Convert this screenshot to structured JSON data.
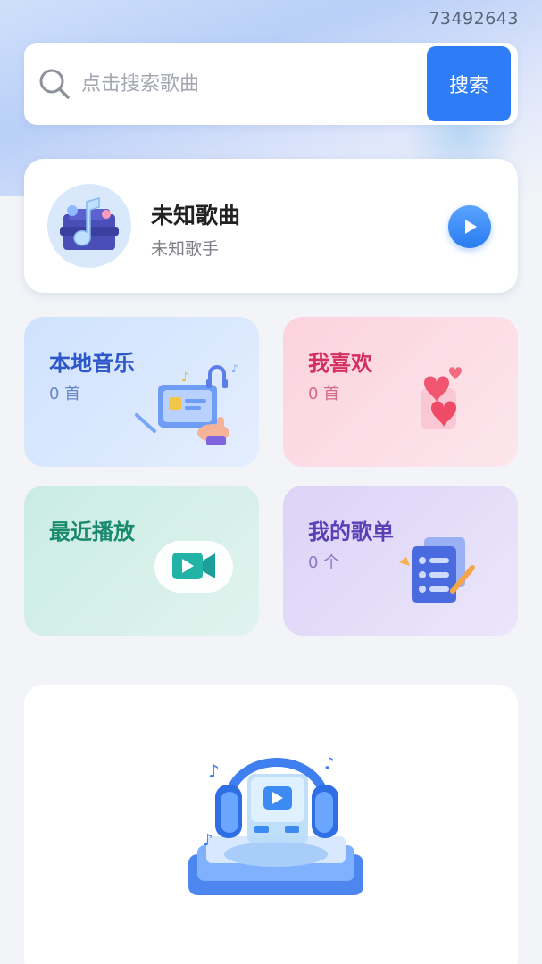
{
  "status": {
    "user_id": "73492643"
  },
  "search": {
    "placeholder": "点击搜索歌曲",
    "button_label": "搜索"
  },
  "now_playing": {
    "title": "未知歌曲",
    "artist": "未知歌手"
  },
  "tiles": {
    "local_music": {
      "title": "本地音乐",
      "count": "0 首"
    },
    "favorites": {
      "title": "我喜欢",
      "count": "0 首"
    },
    "recent": {
      "title": "最近播放"
    },
    "playlists": {
      "title": "我的歌单",
      "count": "0 个"
    }
  },
  "colors": {
    "accent": "#2e7cf6",
    "local": "#2e57c8",
    "favorites": "#d42e63",
    "recent": "#198a6e",
    "playlists": "#5b3fb7"
  },
  "icons": {
    "search": "search-icon",
    "play": "play-icon",
    "video": "video-camera-icon",
    "hearts": "hearts-icon",
    "headphones": "headphones-illustration"
  }
}
